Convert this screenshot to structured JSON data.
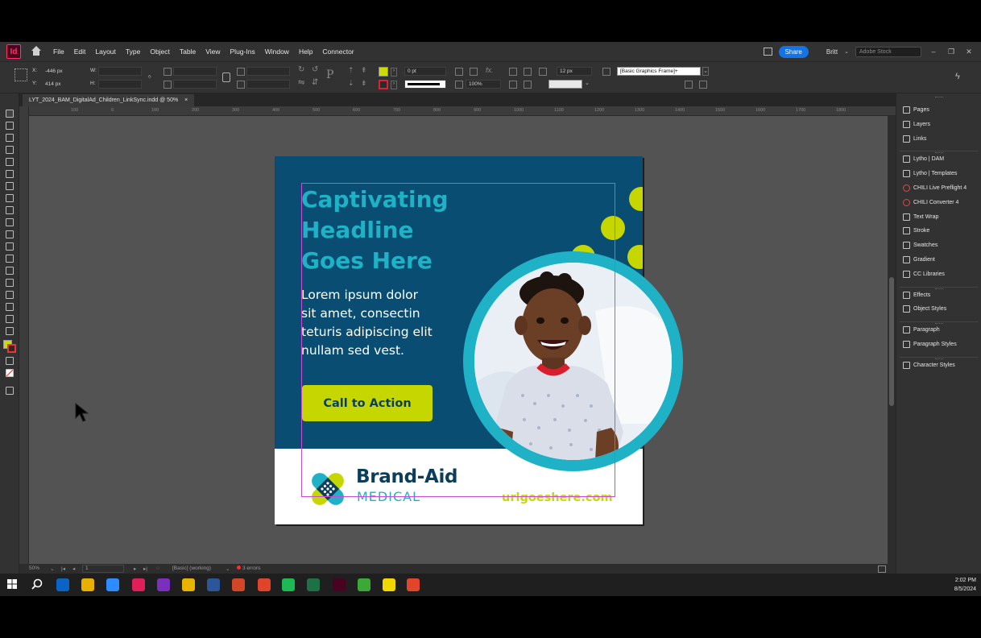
{
  "menubar": {
    "app_logo": "Id",
    "items": [
      "File",
      "Edit",
      "Layout",
      "Type",
      "Object",
      "Table",
      "View",
      "Plug-Ins",
      "Window",
      "Help",
      "Connector"
    ],
    "share_label": "Share",
    "user_name": "Britt",
    "search_placeholder": "Adobe Stock"
  },
  "control_panel": {
    "x_label": "X:",
    "x_value": "-446 px",
    "y_label": "Y:",
    "y_value": "414 px",
    "w_label": "W:",
    "h_label": "H:",
    "stroke_weight": "0 pt",
    "opacity": "100%",
    "gap": "12 px",
    "object_style": "[Basic Graphics Frame]+"
  },
  "document_tab": {
    "title": "LYT_2024_BAM_DigitalAd_Children_LinkSync.indd @ 50%",
    "close": "×"
  },
  "ruler_ticks": [
    "100",
    "0",
    "100",
    "200",
    "300",
    "400",
    "500",
    "600",
    "700",
    "800",
    "900",
    "1000",
    "1100",
    "1200",
    "1300",
    "1400",
    "1500",
    "1600",
    "1700",
    "1800"
  ],
  "status_bar": {
    "zoom": "50%",
    "page": "1",
    "preflight_profile": "[Basic] (working)",
    "errors": "3 errors"
  },
  "right_panels": {
    "group1": [
      {
        "label": "Pages",
        "icon": "pages-icon"
      },
      {
        "label": "Layers",
        "icon": "layers-icon"
      },
      {
        "label": "Links",
        "icon": "links-icon"
      }
    ],
    "group2": [
      {
        "label": "Lytho | DAM",
        "icon": "lytho-dam-icon"
      },
      {
        "label": "Lytho | Templates",
        "icon": "lytho-templates-icon"
      },
      {
        "label": "CHILI Live Preflight 4",
        "icon": "chili-preflight-icon"
      },
      {
        "label": "CHILI Converter 4",
        "icon": "chili-converter-icon"
      },
      {
        "label": "Text Wrap",
        "icon": "text-wrap-icon"
      },
      {
        "label": "Stroke",
        "icon": "stroke-icon"
      },
      {
        "label": "Swatches",
        "icon": "swatches-icon"
      },
      {
        "label": "Gradient",
        "icon": "gradient-icon"
      },
      {
        "label": "CC Libraries",
        "icon": "cc-libraries-icon"
      }
    ],
    "group3": [
      {
        "label": "Effects",
        "icon": "effects-icon"
      },
      {
        "label": "Object Styles",
        "icon": "object-styles-icon"
      }
    ],
    "group4": [
      {
        "label": "Paragraph",
        "icon": "paragraph-icon"
      },
      {
        "label": "Paragraph Styles",
        "icon": "paragraph-styles-icon"
      }
    ],
    "group5": [
      {
        "label": "Character Styles",
        "icon": "character-styles-icon"
      }
    ]
  },
  "ad": {
    "headline_lines": [
      "Captivating",
      "Headline",
      "Goes Here"
    ],
    "body_lines": [
      "Lorem ipsum dolor",
      "sit amet, consectin",
      "teturis adipiscing elit",
      "nullam sed vest."
    ],
    "cta_label": "Call to Action",
    "brand_name": "Brand-Aid",
    "brand_sub": "MEDICAL",
    "url": "urlgoeshere.com",
    "colors": {
      "navy": "#0a4d72",
      "teal": "#1fb2c6",
      "lime": "#c6d600",
      "white": "#ffffff"
    }
  },
  "taskbar": {
    "time": "2:02 PM",
    "date": "8/5/2024",
    "apps": [
      "start-icon",
      "search-icon",
      "outlook-icon",
      "chrome-icon",
      "zoom-icon",
      "slack-icon",
      "onenote-icon",
      "file-explorer-icon",
      "word-icon",
      "powerpoint-icon",
      "snagit-icon",
      "spotify-icon",
      "excel-icon",
      "indesign-icon",
      "camtasia-icon",
      "sticky-notes-icon",
      "snagit-editor-icon"
    ]
  }
}
